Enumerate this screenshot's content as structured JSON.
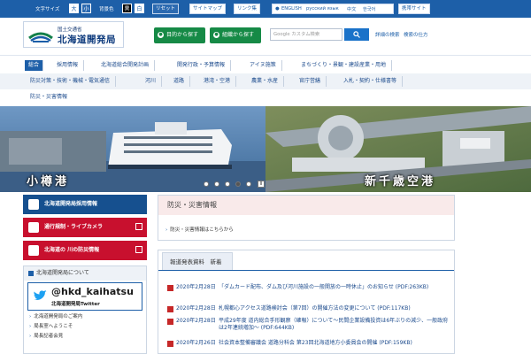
{
  "utility": {
    "font_size_label": "文字サイズ",
    "size_large": "大",
    "size_small": "小",
    "bg_label": "背景色",
    "bg_black": "黒",
    "bg_white": "白",
    "reset": "リセット",
    "sitemap": "サイトマップ",
    "links": "リンク集",
    "lang_en": "ENGLISH",
    "lang_ru": "русский язык",
    "lang_zh": "中文",
    "lang_ko": "한국어",
    "mobile": "携帯サイト"
  },
  "header": {
    "logo_small": "国土交通省",
    "logo_big": "北海道開発局",
    "purpose_search": "目的から探す",
    "org_search": "組織から探す",
    "search_placeholder": "Google カスタム検索",
    "search_detail": "詳細の検索",
    "search_usage": "検索の仕方"
  },
  "nav": {
    "row1": [
      "総合",
      "採用情報",
      "北海道総合開発計画",
      "開発行政・予算情報",
      "アイヌ施策",
      "まちづくり・景観・建設産業・用地"
    ],
    "row2": [
      "防災対策・技術・機械・電気通信",
      "河川",
      "道路",
      "港湾・空港",
      "農業・水産",
      "官庁営繕",
      "入札・契約・仕様書等"
    ],
    "row3": [
      "防災・災害情報"
    ]
  },
  "hero": {
    "caption_left": "小樽港",
    "caption_right": "新千歳空港",
    "slide_index": 4,
    "slide_count": 6
  },
  "left": {
    "recruit": "北海道開発局採用情報",
    "road": "通行規制・ライブカメラ",
    "river": "北海道の 川の防災情報",
    "about_head": "北海道開発局について",
    "twitter_handle": "@hkd_kaihatsu",
    "twitter_sub": "北海道開発局Twitter",
    "links": [
      "北海道開発局のご案内",
      "局長室へようこそ",
      "局長記者会見"
    ]
  },
  "disaster": {
    "heading": "防災・災害情報",
    "link": "防災・災害情報はこちらから"
  },
  "news": {
    "tab": "報道発表資料　新着",
    "items": [
      {
        "date": "2020年2月28日",
        "text": "「ダムカード配布、ダム及び河川施設の一般開放の一時休止」のお知らせ (PDF:263KB)"
      },
      {
        "date": "2020年2月28日",
        "text": "札幌都心アクセス道路検討会（第7回）の開催方法の変更について (PDF:117KB)"
      },
      {
        "date": "2020年2月28日",
        "text": "平成29年度 道内総合手形観察（確報）について～民間企業設備投資は6年ぶりの減少、一般政府は2年連続増加～ (PDF:644KB)"
      },
      {
        "date": "2020年2月26日",
        "text": "社会資本整備審議会 道路分科会 第23回北海道地方小委員会の開催 (PDF:159KB)"
      }
    ]
  },
  "colors": {
    "primary": "#1d5fa8",
    "green": "#168a46",
    "red": "#c8102e",
    "navy": "#16508f"
  }
}
